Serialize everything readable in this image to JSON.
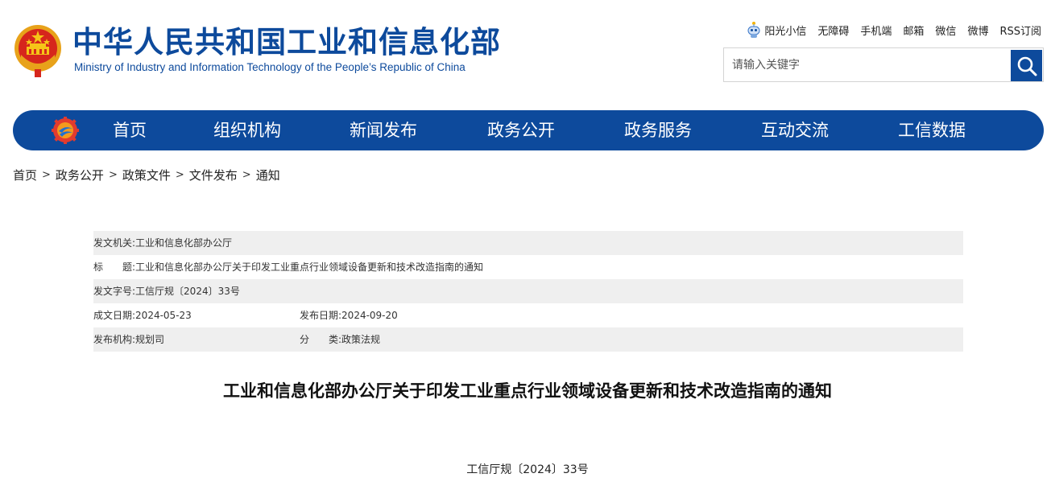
{
  "header": {
    "title_cn": "中华人民共和国工业和信息化部",
    "title_en": "Ministry of Industry and Information Technology of the People’s Republic of China",
    "toplinks": [
      "阳光小信",
      "无障碍",
      "手机端",
      "邮箱",
      "微信",
      "微博",
      "RSS订阅"
    ],
    "search_placeholder": "请输入关键字"
  },
  "nav": {
    "items": [
      "首页",
      "组织机构",
      "新闻发布",
      "政务公开",
      "政务服务",
      "互动交流",
      "工信数据"
    ]
  },
  "breadcrumb": [
    "首页",
    "政务公开",
    "政策文件",
    "文件发布",
    "通知"
  ],
  "breadcrumb_sep": ">",
  "info": {
    "issuer_label": "发文机关:",
    "issuer": "工业和信息化部办公厅",
    "title_label": "标　　题:",
    "title": "工业和信息化部办公厅关于印发工业重点行业领域设备更新和技术改造指南的通知",
    "docno_label": "发文字号:",
    "docno": "工信厅规〔2024〕33号",
    "created_label": "成文日期:",
    "created": "2024-05-23",
    "published_label": "发布日期:",
    "published": "2024-09-20",
    "org_label": "发布机构:",
    "org": "规划司",
    "category_label": "分　　类:",
    "category": "政策法规"
  },
  "doc": {
    "title": "工业和信息化部办公厅关于印发工业重点行业领域设备更新和技术改造指南的通知",
    "number": "工信厅规〔2024〕33号"
  },
  "colors": {
    "brand_blue": "#0d4a9c",
    "row_shade": "#efefef"
  }
}
